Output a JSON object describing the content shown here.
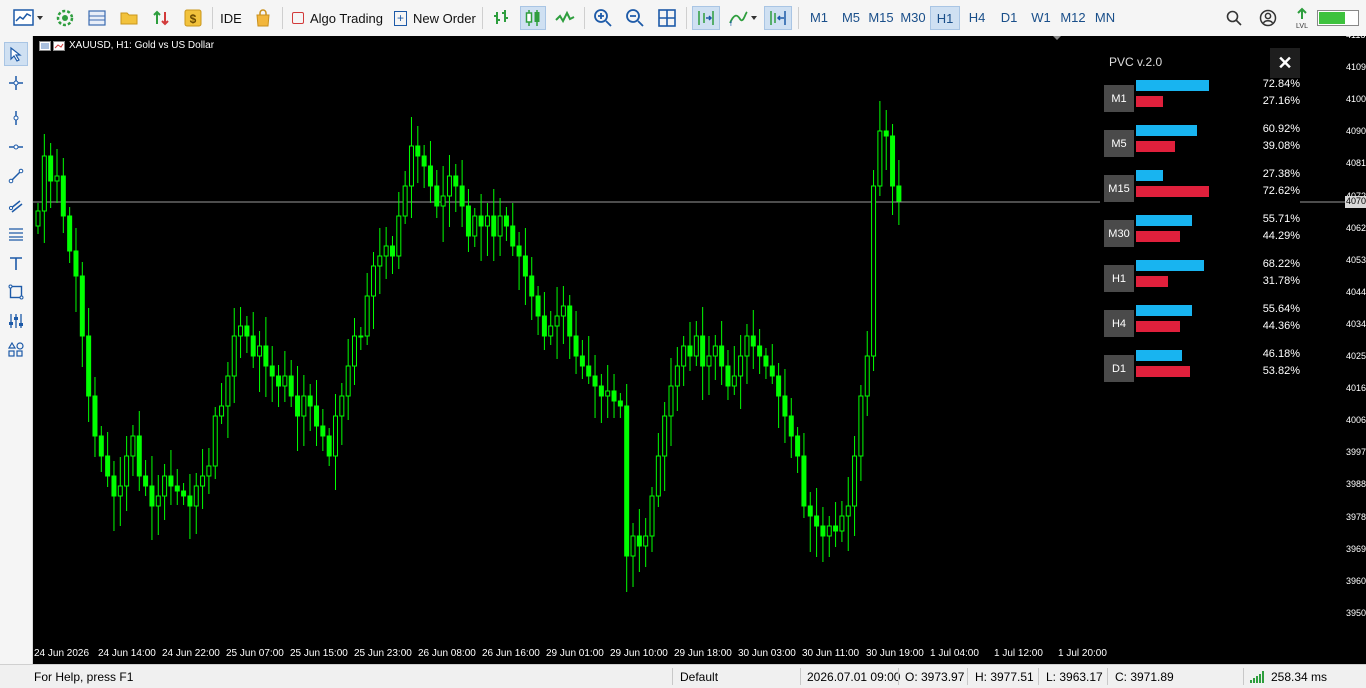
{
  "toolbar": {
    "ide_label": "IDE",
    "algo_label": "Algo Trading",
    "new_order_label": "New Order",
    "timeframes": [
      "M1",
      "M5",
      "M15",
      "M30",
      "H1",
      "H4",
      "D1",
      "W1",
      "M12",
      "MN"
    ],
    "active_timeframe": "H1"
  },
  "chart": {
    "symbol_title": "XAUUSD, H1:  Gold vs US Dollar",
    "current_price": "4070.62",
    "bull_color": "#00ff00",
    "bear_candle_fill": "#000000",
    "y_labels": [
      "4118.95",
      "4109.60",
      "4100.25",
      "4090.90",
      "4081.55",
      "4072.20",
      "4062.85",
      "4053.50",
      "4044.15",
      "4034.80",
      "4025.45",
      "4016.10",
      "4006.75",
      "3997.40",
      "3988.05",
      "3978.70",
      "3969.35",
      "3960.00",
      "3950.65"
    ],
    "x_labels": [
      "24 Jun 2026",
      "24 Jun 14:00",
      "24 Jun 22:00",
      "25 Jun 07:00",
      "25 Jun 15:00",
      "25 Jun 23:00",
      "26 Jun 08:00",
      "26 Jun 16:00",
      "29 Jun 01:00",
      "29 Jun 10:00",
      "29 Jun 18:00",
      "30 Jun 03:00",
      "30 Jun 11:00",
      "30 Jun 19:00",
      "1 Jul 04:00",
      "1 Jul 12:00",
      "1 Jul 20:00"
    ]
  },
  "pvc": {
    "title": "PVC v.2.0",
    "bull_color": "#18b4f0",
    "bear_color": "#e0203c",
    "rows": [
      {
        "tf": "M1",
        "bull": "72.84%",
        "bear": "27.16%",
        "bull_val": 72.84,
        "bear_val": 27.16
      },
      {
        "tf": "M5",
        "bull": "60.92%",
        "bear": "39.08%",
        "bull_val": 60.92,
        "bear_val": 39.08
      },
      {
        "tf": "M15",
        "bull": "27.38%",
        "bear": "72.62%",
        "bull_val": 27.38,
        "bear_val": 72.62
      },
      {
        "tf": "M30",
        "bull": "55.71%",
        "bear": "44.29%",
        "bull_val": 55.71,
        "bear_val": 44.29
      },
      {
        "tf": "H1",
        "bull": "68.22%",
        "bear": "31.78%",
        "bull_val": 68.22,
        "bear_val": 31.78
      },
      {
        "tf": "H4",
        "bull": "55.64%",
        "bear": "44.36%",
        "bull_val": 55.64,
        "bear_val": 44.36
      },
      {
        "tf": "D1",
        "bull": "46.18%",
        "bear": "53.82%",
        "bull_val": 46.18,
        "bear_val": 53.82
      }
    ]
  },
  "status": {
    "help": "For Help, press F1",
    "profile": "Default",
    "datetime": "2026.07.01 09:00",
    "open": "O: 3973.97",
    "high": "H: 3977.51",
    "low": "L: 3963.17",
    "close": "C: 3971.89",
    "ping": "258.34 ms"
  }
}
